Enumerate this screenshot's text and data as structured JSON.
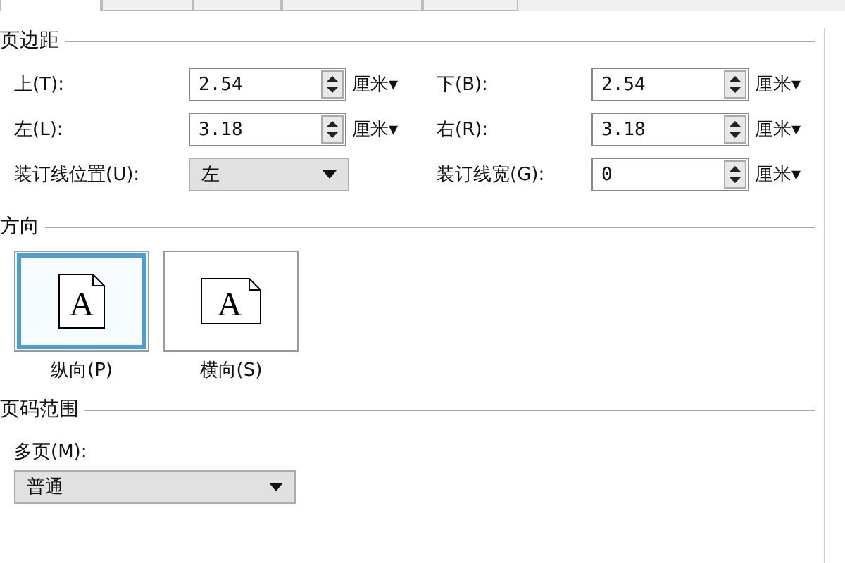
{
  "tabs": [
    {
      "selected": true
    },
    {
      "selected": false
    },
    {
      "selected": false
    },
    {
      "selected": false
    },
    {
      "selected": false
    }
  ],
  "margins": {
    "title": "页边距",
    "fields": [
      {
        "kind": "spin",
        "label": "上(T):",
        "value": "2.54",
        "unit": "厘米▾"
      },
      {
        "kind": "spin",
        "label": "下(B):",
        "value": "2.54",
        "unit": "厘米▾"
      },
      {
        "kind": "spin",
        "label": "左(L):",
        "value": "3.18",
        "unit": "厘米▾"
      },
      {
        "kind": "spin",
        "label": "右(R):",
        "value": "3.18",
        "unit": "厘米▾"
      },
      {
        "kind": "dropdown",
        "label": "装订线位置(U):",
        "value": "左"
      },
      {
        "kind": "spin",
        "label": "装订线宽(G):",
        "value": "0",
        "unit": "厘米▾"
      }
    ]
  },
  "orientation": {
    "title": "方向",
    "options": [
      {
        "kind": "portrait",
        "glyph": "A",
        "label": "纵向(P)",
        "selected": true
      },
      {
        "kind": "landscape",
        "glyph": "A",
        "label": "横向(S)",
        "selected": false
      }
    ]
  },
  "pages": {
    "title": "页码范围",
    "label": "多页(M):",
    "value": "普通"
  }
}
